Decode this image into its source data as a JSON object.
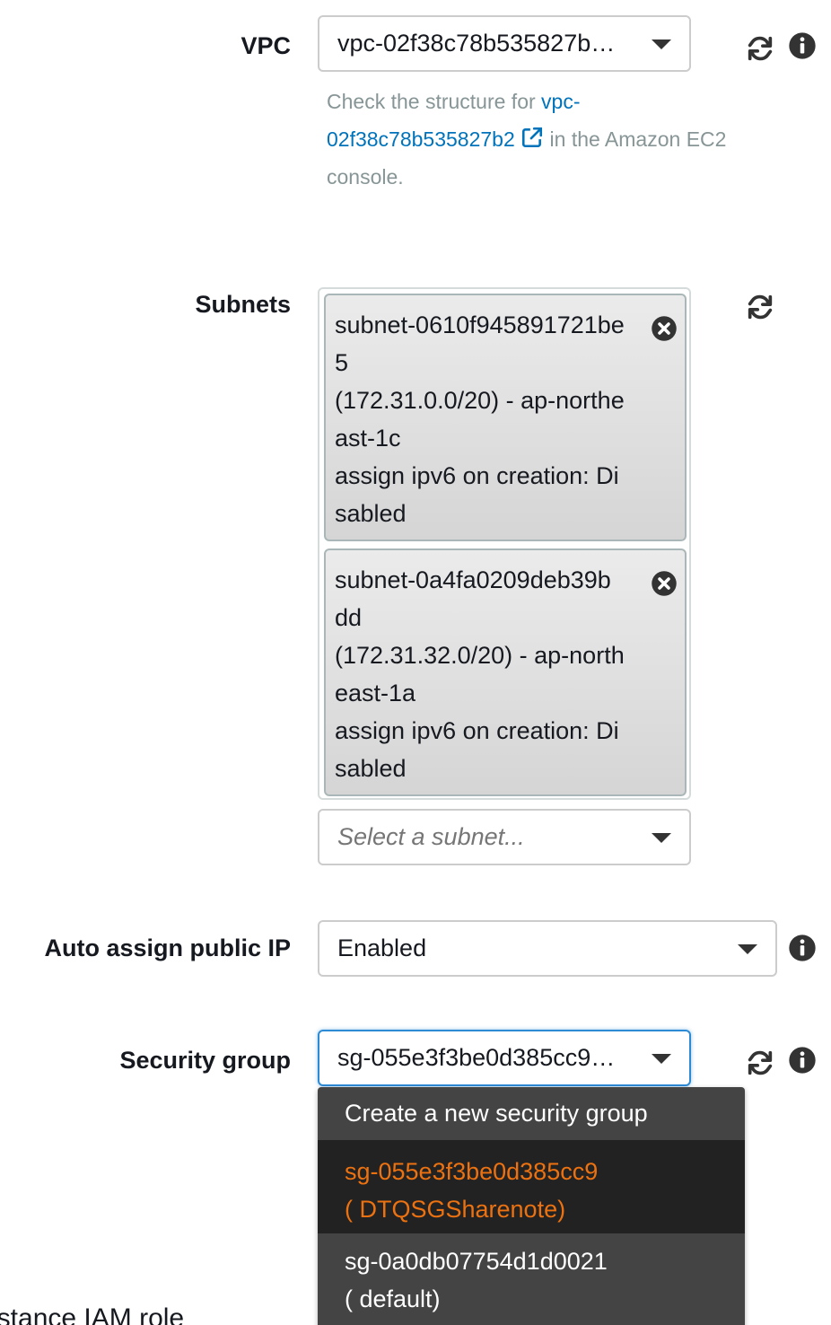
{
  "vpc": {
    "label": "VPC",
    "value": "vpc-02f38c78b535827b…",
    "help_prefix": "Check the structure for ",
    "help_link_line1": "vpc-",
    "help_link_line2": "02f38c78b535827b2",
    "help_suffix": " in the Amazon EC2",
    "help_line3": "console."
  },
  "subnets": {
    "label": "Subnets",
    "chips": [
      {
        "lines": [
          "subnet-0610f945891721be",
          "5",
          "(172.31.0.0/20) - ap-northe",
          "ast-1c",
          "assign ipv6 on creation: Di",
          "sabled"
        ]
      },
      {
        "lines": [
          "subnet-0a4fa0209deb39b",
          "dd",
          "(172.31.32.0/20) - ap-north",
          "east-1a",
          "assign ipv6 on creation: Di",
          "sabled"
        ]
      }
    ],
    "placeholder": "Select a subnet..."
  },
  "auto_ip": {
    "label": "Auto assign public IP",
    "value": "Enabled"
  },
  "security_group": {
    "label": "Security group",
    "value": "sg-055e3f3be0d385cc9…",
    "menu": {
      "create": "Create a new security group",
      "options": [
        {
          "line1": "sg-055e3f3be0d385cc9",
          "line2": "( DTQSGSharenote)"
        },
        {
          "line1": "sg-0a0db07754d1d0021",
          "line2": "( default)"
        }
      ]
    }
  },
  "next_field_label_partial": "nstance IAM role",
  "colors": {
    "link": "#0073bb",
    "active_option": "#ec7211",
    "menu_bg": "#444444",
    "focus_border": "#2d8bd6"
  }
}
